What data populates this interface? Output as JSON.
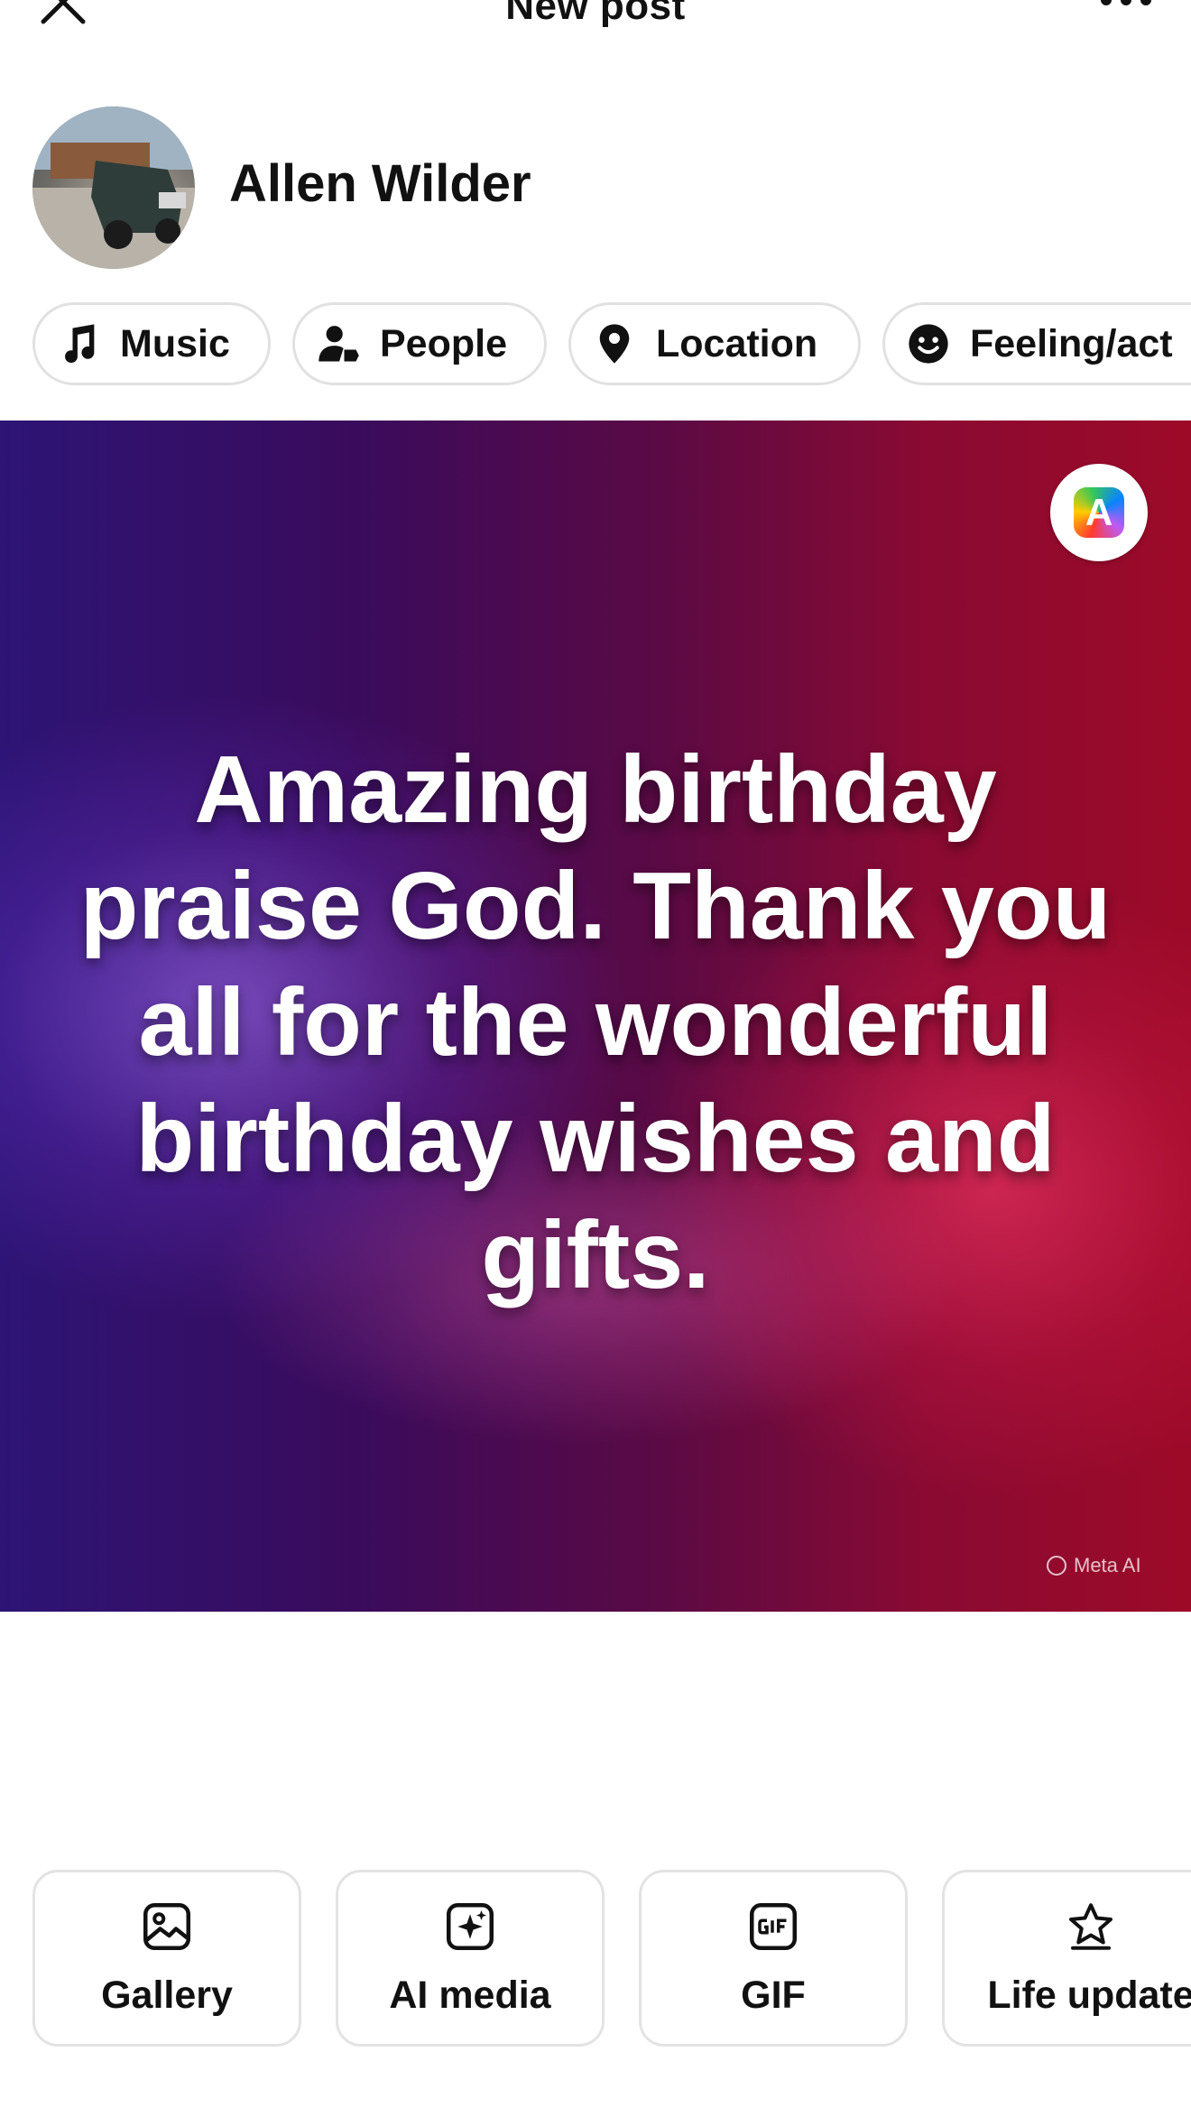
{
  "header": {
    "title": "New post",
    "close_icon": "close-icon",
    "more_icon": "more-horizontal-icon"
  },
  "user": {
    "name": "Allen Wilder",
    "avatar": "avatar-photo-truck"
  },
  "chips": [
    {
      "label": "Music",
      "icon": "music-note-icon"
    },
    {
      "label": "People",
      "icon": "person-tag-icon"
    },
    {
      "label": "Location",
      "icon": "location-pin-icon"
    },
    {
      "label": "Feeling/act",
      "icon": "smiley-icon"
    }
  ],
  "media": {
    "text": "Amazing birthday praise God. Thank you all for the wonderful birthday wishes and gifts.",
    "badge_letter": "A",
    "watermark": "Meta AI",
    "colors": {
      "left": "#2d1475",
      "right": "#9d0a28"
    }
  },
  "actions": [
    {
      "label": "Gallery",
      "icon": "image-icon"
    },
    {
      "label": "AI media",
      "icon": "ai-sparkle-icon"
    },
    {
      "label": "GIF",
      "icon": "gif-icon"
    },
    {
      "label": "Life update",
      "icon": "star-icon"
    }
  ]
}
